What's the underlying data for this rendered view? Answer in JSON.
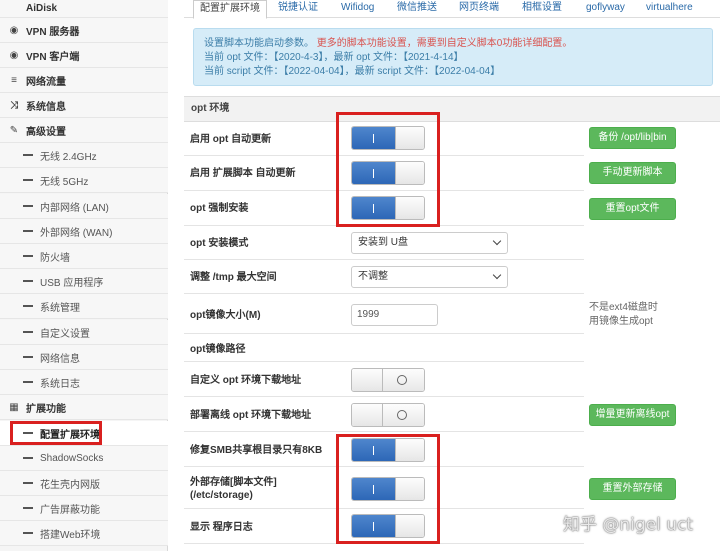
{
  "sidebar": {
    "items": [
      {
        "label": "AiDisk",
        "icon": "disk-icon",
        "level": "top"
      },
      {
        "label": "VPN 服务器",
        "icon": "globe-icon",
        "level": "top"
      },
      {
        "label": "VPN 客户端",
        "icon": "globe-icon",
        "level": "top"
      },
      {
        "label": "网络流量",
        "icon": "list-icon",
        "level": "top"
      },
      {
        "label": "系统信息",
        "icon": "shuffle-icon",
        "level": "top"
      },
      {
        "label": "高级设置",
        "icon": "wrench-icon",
        "level": "top"
      },
      {
        "label": "无线 2.4GHz",
        "level": "sub"
      },
      {
        "label": "无线 5GHz",
        "level": "sub"
      },
      {
        "label": "内部网络 (LAN)",
        "level": "sub"
      },
      {
        "label": "外部网络 (WAN)",
        "level": "sub"
      },
      {
        "label": "防火墙",
        "level": "sub"
      },
      {
        "label": "USB 应用程序",
        "level": "sub"
      },
      {
        "label": "系统管理",
        "level": "sub"
      },
      {
        "label": "自定义设置",
        "level": "sub"
      },
      {
        "label": "网络信息",
        "level": "sub"
      },
      {
        "label": "系统日志",
        "level": "sub"
      },
      {
        "label": "扩展功能",
        "icon": "grid-icon",
        "level": "top"
      },
      {
        "label": "配置扩展环境",
        "level": "sub",
        "active": true
      },
      {
        "label": "ShadowSocks",
        "level": "sub"
      },
      {
        "label": "花生壳内网版",
        "level": "sub"
      },
      {
        "label": "广告屏蔽功能",
        "level": "sub"
      },
      {
        "label": "搭建Web环境",
        "level": "sub"
      }
    ]
  },
  "tabs": [
    "配置扩展环境",
    "锐捷认证",
    "Wifidog",
    "微信推送",
    "网页终端",
    "相框设置",
    "goflyway",
    "virtualhere"
  ],
  "info": {
    "line1": "设置脚本功能启动参数。",
    "line1_warn": "更多的脚本功能设置，需要到自定义脚本0功能详细配置。",
    "line2": "当前 opt 文件：【2020-4-3】，最新 opt 文件：【2021-4-14】",
    "line3": "当前 script 文件：【2022-04-04】，最新 script 文件：【2022-04-04】"
  },
  "section_title": "opt 环境",
  "rows": {
    "auto_update_opt": "启用 opt 自动更新",
    "auto_update_script": "启用 扩展脚本 自动更新",
    "force_install_opt": "opt 强制安装",
    "install_mode": "opt 安装模式",
    "tmp_max": "调整 /tmp 最大空间",
    "image_size": "opt镜像大小(M)",
    "image_path": "opt镜像路径",
    "custom_download": "自定义 opt 环境下载地址",
    "offline_download": "部署离线 opt 环境下载地址",
    "smb_fix": "修复SMB共享根目录只有8KB",
    "ext_storage_1": "外部存储[脚本文件]",
    "ext_storage_2": "(/etc/storage)",
    "show_log": "显示 程序日志"
  },
  "selects": {
    "install_mode": "安装到 U盘",
    "tmp_max": "不调整"
  },
  "inputs": {
    "image_size": "1999"
  },
  "buttons": {
    "backup_opt": "备份 /opt/lib|bin",
    "manual_update": "手动更新脚本",
    "reset_opt": "重置opt文件",
    "incremental_update": "增量更新离线opt",
    "reset_storage": "重置外部存储"
  },
  "note": {
    "line1": "不是ext4磁盘时",
    "line2": "用镜像生成opt"
  },
  "watermark": "知乎 @nigel uct",
  "colors": {
    "toggle_on": "#3470bd",
    "button_green": "#5cb85c",
    "highlight_red": "#d9201f",
    "info_bg": "#d6ecf8"
  }
}
